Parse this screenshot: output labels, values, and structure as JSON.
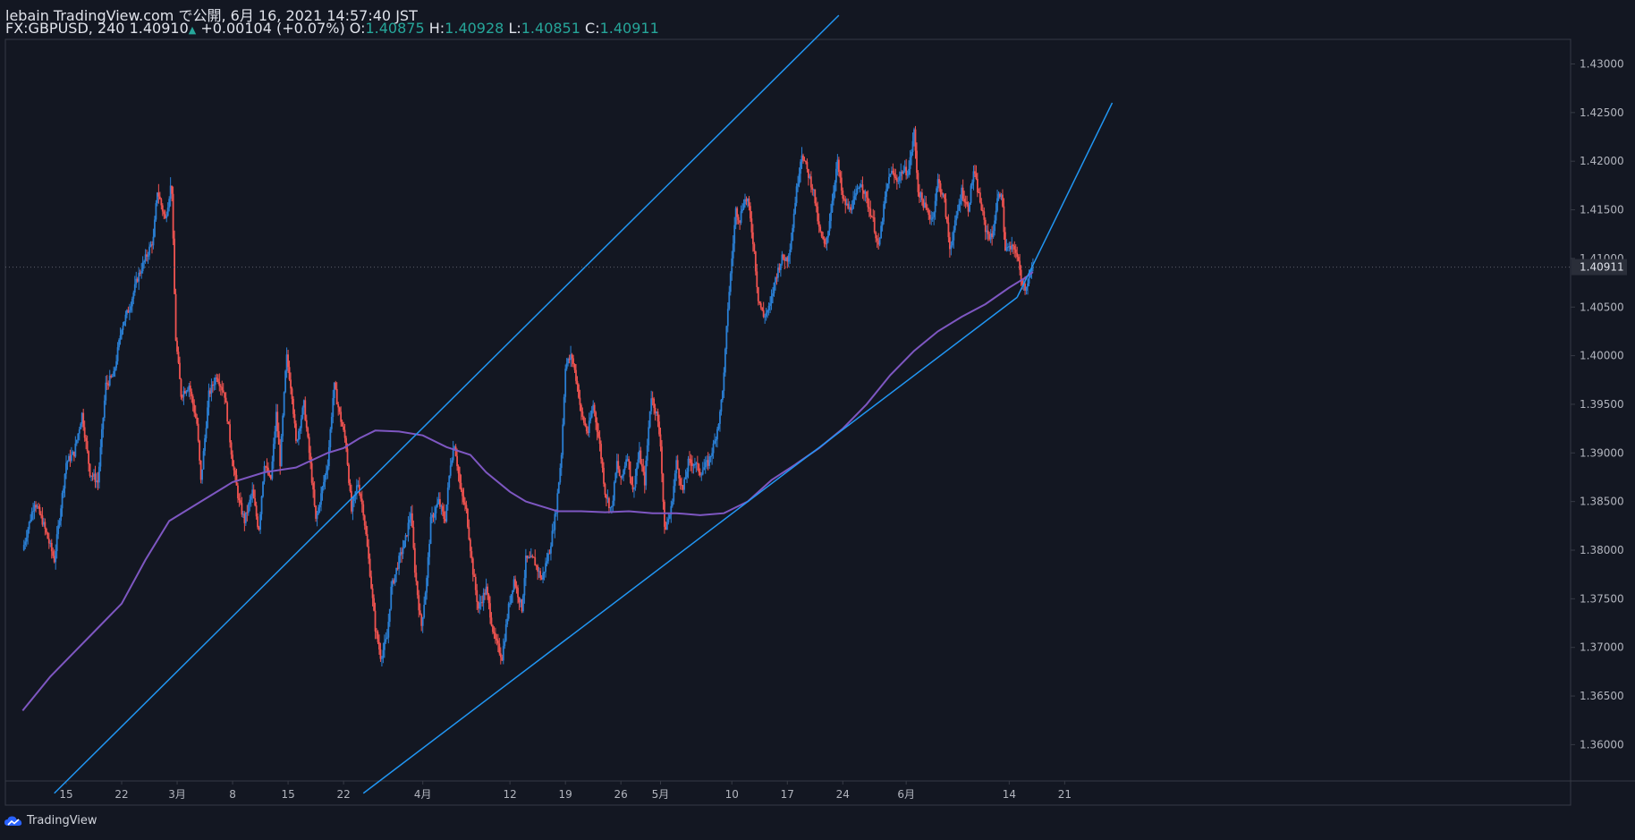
{
  "header": {
    "line1": "lebain TradingView.com で公開, 6月 16, 2021 14:57:40 JST",
    "symbol": "FX:GBPUSD, 240",
    "last": "1.40910",
    "change": "+0.00104 (+0.07%)",
    "o_label": "O:",
    "o": "1.40875",
    "h_label": "H:",
    "h": "1.40928",
    "l_label": "L:",
    "l": "1.40851",
    "c_label": "C:",
    "c": "1.40911"
  },
  "brand": {
    "label": "TradingView",
    "icon": "tradingview-cloud-icon"
  },
  "colors": {
    "bg": "#131722",
    "up": "#2a7fd4",
    "down": "#ef5350",
    "ma": "#7e57c2",
    "channel": "#2196f3",
    "grid": "#2a2e39",
    "text": "#b2b5be"
  },
  "chart_data": {
    "type": "candlestick",
    "symbol": "GBPUSD",
    "timeframe": "240",
    "ylim": [
      1.3555,
      1.4325
    ],
    "y_ticks": [
      "1.43000",
      "1.42500",
      "1.42000",
      "1.41500",
      "1.41000",
      "1.40500",
      "1.40000",
      "1.39500",
      "1.39000",
      "1.38500",
      "1.38000",
      "1.37500",
      "1.37000",
      "1.36500",
      "1.36000"
    ],
    "x_ticks": [
      {
        "label": "15",
        "day": 0
      },
      {
        "label": "22",
        "day": 7
      },
      {
        "label": "3月",
        "day": 14
      },
      {
        "label": "8",
        "day": 21
      },
      {
        "label": "15",
        "day": 28
      },
      {
        "label": "22",
        "day": 35
      },
      {
        "label": "4月",
        "day": 45
      },
      {
        "label": "12",
        "day": 56
      },
      {
        "label": "19",
        "day": 63
      },
      {
        "label": "26",
        "day": 70
      },
      {
        "label": "5月",
        "day": 75
      },
      {
        "label": "10",
        "day": 84
      },
      {
        "label": "17",
        "day": 91
      },
      {
        "label": "24",
        "day": 98
      },
      {
        "label": "6月",
        "day": 106
      },
      {
        "label": "14",
        "day": 119
      },
      {
        "label": "21",
        "day": 126
      }
    ],
    "last_price_label": "1.40911",
    "close_path": [
      [
        -5.5,
        1.38
      ],
      [
        -4,
        1.385
      ],
      [
        -3,
        1.383
      ],
      [
        -1.5,
        1.379
      ],
      [
        0,
        1.389
      ],
      [
        1,
        1.39
      ],
      [
        2,
        1.394
      ],
      [
        3,
        1.388
      ],
      [
        4,
        1.387
      ],
      [
        5,
        1.397
      ],
      [
        6,
        1.398
      ],
      [
        7,
        1.403
      ],
      [
        8,
        1.405
      ],
      [
        9,
        1.408
      ],
      [
        10,
        1.41
      ],
      [
        11,
        1.412
      ],
      [
        11.5,
        1.417
      ],
      [
        12.5,
        1.414
      ],
      [
        13.3,
        1.418
      ],
      [
        13.8,
        1.402
      ],
      [
        14.5,
        1.396
      ],
      [
        15.5,
        1.397
      ],
      [
        16.5,
        1.393
      ],
      [
        17,
        1.387
      ],
      [
        18,
        1.396
      ],
      [
        19,
        1.398
      ],
      [
        20,
        1.396
      ],
      [
        21,
        1.389
      ],
      [
        21.8,
        1.385
      ],
      [
        22.5,
        1.383
      ],
      [
        23.5,
        1.386
      ],
      [
        24.3,
        1.382
      ],
      [
        25,
        1.389
      ],
      [
        25.8,
        1.387
      ],
      [
        26.5,
        1.394
      ],
      [
        27,
        1.389
      ],
      [
        27.8,
        1.4
      ],
      [
        28.5,
        1.396
      ],
      [
        29,
        1.391
      ],
      [
        30,
        1.395
      ],
      [
        30.8,
        1.389
      ],
      [
        31.5,
        1.383
      ],
      [
        32.5,
        1.387
      ],
      [
        33,
        1.389
      ],
      [
        33.8,
        1.397
      ],
      [
        34.5,
        1.394
      ],
      [
        35.3,
        1.391
      ],
      [
        36,
        1.384
      ],
      [
        36.8,
        1.387
      ],
      [
        37.5,
        1.384
      ],
      [
        38.3,
        1.378
      ],
      [
        39,
        1.372
      ],
      [
        39.7,
        1.369
      ],
      [
        40.5,
        1.371
      ],
      [
        41,
        1.376
      ],
      [
        42,
        1.379
      ],
      [
        42.8,
        1.381
      ],
      [
        43.5,
        1.384
      ],
      [
        44,
        1.378
      ],
      [
        44.8,
        1.372
      ],
      [
        45.5,
        1.377
      ],
      [
        46,
        1.383
      ],
      [
        47,
        1.385
      ],
      [
        47.8,
        1.383
      ],
      [
        48.5,
        1.389
      ],
      [
        49,
        1.391
      ],
      [
        49.8,
        1.386
      ],
      [
        50.5,
        1.384
      ],
      [
        51.3,
        1.378
      ],
      [
        52,
        1.374
      ],
      [
        53,
        1.376
      ],
      [
        54,
        1.371
      ],
      [
        55,
        1.369
      ],
      [
        55.8,
        1.374
      ],
      [
        56.5,
        1.377
      ],
      [
        57.5,
        1.374
      ],
      [
        58,
        1.379
      ],
      [
        59,
        1.379
      ],
      [
        60,
        1.377
      ],
      [
        61,
        1.38
      ],
      [
        61.8,
        1.384
      ],
      [
        62.5,
        1.39
      ],
      [
        63,
        1.399
      ],
      [
        63.8,
        1.4
      ],
      [
        64.5,
        1.397
      ],
      [
        65,
        1.394
      ],
      [
        65.8,
        1.392
      ],
      [
        66.5,
        1.395
      ],
      [
        67.3,
        1.391
      ],
      [
        68,
        1.386
      ],
      [
        68.8,
        1.384
      ],
      [
        69.5,
        1.389
      ],
      [
        70,
        1.387
      ],
      [
        70.8,
        1.39
      ],
      [
        71.5,
        1.386
      ],
      [
        72.3,
        1.39
      ],
      [
        73,
        1.387
      ],
      [
        73.8,
        1.396
      ],
      [
        74.5,
        1.394
      ],
      [
        75,
        1.391
      ],
      [
        75.5,
        1.382
      ],
      [
        76.3,
        1.384
      ],
      [
        77,
        1.389
      ],
      [
        77.8,
        1.386
      ],
      [
        78.5,
        1.389
      ],
      [
        79.3,
        1.389
      ],
      [
        80,
        1.388
      ],
      [
        81,
        1.389
      ],
      [
        81.8,
        1.391
      ],
      [
        82.5,
        1.394
      ],
      [
        83,
        1.398
      ],
      [
        83.5,
        1.405
      ],
      [
        84,
        1.41
      ],
      [
        84.5,
        1.415
      ],
      [
        85,
        1.414
      ],
      [
        85.5,
        1.416
      ],
      [
        86,
        1.416
      ],
      [
        86.8,
        1.411
      ],
      [
        87.3,
        1.406
      ],
      [
        88,
        1.404
      ],
      [
        88.8,
        1.405
      ],
      [
        89.5,
        1.408
      ],
      [
        90.3,
        1.41
      ],
      [
        91,
        1.41
      ],
      [
        91.5,
        1.412
      ],
      [
        92,
        1.416
      ],
      [
        92.8,
        1.421
      ],
      [
        93.5,
        1.419
      ],
      [
        94.3,
        1.417
      ],
      [
        95,
        1.413
      ],
      [
        95.8,
        1.411
      ],
      [
        96.5,
        1.415
      ],
      [
        97.3,
        1.42
      ],
      [
        98,
        1.416
      ],
      [
        98.8,
        1.415
      ],
      [
        99.5,
        1.416
      ],
      [
        100.3,
        1.418
      ],
      [
        101,
        1.416
      ],
      [
        101.8,
        1.414
      ],
      [
        102.5,
        1.411
      ],
      [
        103.3,
        1.416
      ],
      [
        104,
        1.419
      ],
      [
        104.8,
        1.418
      ],
      [
        105.5,
        1.419
      ],
      [
        106.3,
        1.419
      ],
      [
        107,
        1.423
      ],
      [
        107.5,
        1.417
      ],
      [
        108.5,
        1.415
      ],
      [
        109.3,
        1.414
      ],
      [
        110,
        1.418
      ],
      [
        110.8,
        1.416
      ],
      [
        111.5,
        1.411
      ],
      [
        112.3,
        1.414
      ],
      [
        113,
        1.417
      ],
      [
        113.8,
        1.415
      ],
      [
        114.5,
        1.419
      ],
      [
        115.3,
        1.416
      ],
      [
        116,
        1.413
      ],
      [
        116.8,
        1.412
      ],
      [
        117.5,
        1.416
      ],
      [
        118,
        1.417
      ],
      [
        118.5,
        1.411
      ],
      [
        119,
        1.411
      ],
      [
        119.8,
        1.411
      ],
      [
        120.5,
        1.408
      ],
      [
        121,
        1.407
      ],
      [
        121.5,
        1.408
      ],
      [
        122,
        1.409
      ]
    ],
    "ma_path": [
      [
        -5.5,
        1.3635
      ],
      [
        -2,
        1.367
      ],
      [
        1,
        1.3695
      ],
      [
        4,
        1.372
      ],
      [
        7,
        1.3745
      ],
      [
        10,
        1.379
      ],
      [
        13,
        1.383
      ],
      [
        17,
        1.385
      ],
      [
        21,
        1.387
      ],
      [
        25,
        1.388
      ],
      [
        29,
        1.3885
      ],
      [
        33,
        1.39
      ],
      [
        35,
        1.3905
      ],
      [
        37,
        1.3915
      ],
      [
        39,
        1.3923
      ],
      [
        42,
        1.3922
      ],
      [
        45,
        1.3918
      ],
      [
        48,
        1.3906
      ],
      [
        51,
        1.3898
      ],
      [
        53,
        1.388
      ],
      [
        56,
        1.386
      ],
      [
        58,
        1.385
      ],
      [
        60,
        1.3845
      ],
      [
        62,
        1.384
      ],
      [
        65,
        1.384
      ],
      [
        68,
        1.3839
      ],
      [
        71,
        1.384
      ],
      [
        74,
        1.3838
      ],
      [
        77,
        1.3838
      ],
      [
        80,
        1.3836
      ],
      [
        83,
        1.3838
      ],
      [
        86,
        1.385
      ],
      [
        89,
        1.3872
      ],
      [
        92,
        1.3888
      ],
      [
        95,
        1.3905
      ],
      [
        98,
        1.3925
      ],
      [
        101,
        1.395
      ],
      [
        104,
        1.398
      ],
      [
        107,
        1.4005
      ],
      [
        110,
        1.4025
      ],
      [
        113,
        1.404
      ],
      [
        116,
        1.4053
      ],
      [
        119,
        1.407
      ],
      [
        121,
        1.408
      ],
      [
        122,
        1.4086
      ]
    ],
    "channel_lines": [
      {
        "name": "upper",
        "from": [
          -1.5,
          1.355
        ],
        "to": [
          97.5,
          1.435
        ]
      },
      {
        "name": "lower",
        "from": [
          37.5,
          1.355
        ],
        "to": [
          120,
          1.406
        ]
      },
      {
        "name": "lower-extension",
        "from": [
          120,
          1.406
        ],
        "to": [
          132,
          1.426
        ]
      }
    ]
  }
}
